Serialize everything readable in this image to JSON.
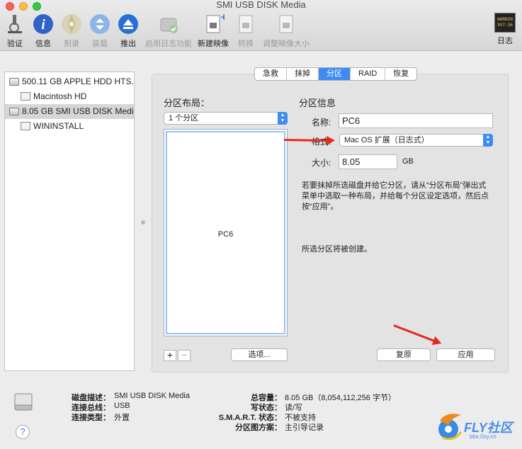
{
  "window": {
    "title": "SMI USB DISK Media"
  },
  "toolbar": {
    "items": [
      {
        "label": "验证",
        "icon": "microscope-icon",
        "enabled": true
      },
      {
        "label": "信息",
        "icon": "info-icon",
        "enabled": true
      },
      {
        "label": "刻录",
        "icon": "burn-disc-icon",
        "enabled": false
      },
      {
        "label": "装载",
        "icon": "mount-icon",
        "enabled": false
      },
      {
        "label": "推出",
        "icon": "eject-icon",
        "enabled": true
      },
      {
        "label": "启用日志功能",
        "icon": "journal-icon",
        "enabled": false
      },
      {
        "label": "新建映像",
        "icon": "new-image-icon",
        "enabled": true
      },
      {
        "label": "转换",
        "icon": "convert-icon",
        "enabled": false
      },
      {
        "label": "调整映像大小",
        "icon": "resize-image-icon",
        "enabled": false
      }
    ],
    "log": {
      "label": "日志",
      "badge_line1": "WARNIN",
      "badge_line2": "9V7:36"
    }
  },
  "sidebar": {
    "items": [
      {
        "label": "500.11 GB APPLE HDD HTS...",
        "kind": "drive",
        "selected": false
      },
      {
        "label": "Macintosh HD",
        "kind": "volume",
        "selected": false
      },
      {
        "label": "8.05 GB SMI USB DISK Media",
        "kind": "drive",
        "selected": true
      },
      {
        "label": "WININSTALL",
        "kind": "volume",
        "selected": false
      }
    ]
  },
  "tabs": [
    {
      "label": "急救",
      "active": false
    },
    {
      "label": "抹掉",
      "active": false
    },
    {
      "label": "分区",
      "active": true
    },
    {
      "label": "RAID",
      "active": false
    },
    {
      "label": "恢复",
      "active": false
    }
  ],
  "partition": {
    "layout_title": "分区布局：",
    "layout_select": "1 个分区",
    "partition_name_in_layout": "PC6",
    "info_title": "分区信息",
    "name_label": "名称:",
    "name_value": "PC6",
    "format_label": "格式:",
    "format_value": "Mac OS 扩展（日志式）",
    "size_label": "大小:",
    "size_value": "8.05",
    "size_unit": "GB",
    "description": "若要抹掉所选磁盘并给它分区，请从“分区布局”弹出式菜单中选取一种布局，并给每个分区设定选项，然后点按“应用”。",
    "status": "所选分区将被创建。",
    "plus_label": "+",
    "minus_label": "−",
    "options_button": "选项...",
    "revert_button": "复原",
    "apply_button": "应用"
  },
  "footer": {
    "left": [
      {
        "key": "磁盘描述：",
        "value": "SMI USB DISK Media"
      },
      {
        "key": "连接总线：",
        "value": "USB"
      },
      {
        "key": "连接类型：",
        "value": "外置"
      }
    ],
    "right": [
      {
        "key": "总容量：",
        "value": "8.05 GB（8,054,112,256 字节）"
      },
      {
        "key": "写状态：",
        "value": "读/写"
      },
      {
        "key": "S.M.A.R.T. 状态：",
        "value": "不被支持"
      },
      {
        "key": "分区图方案：",
        "value": "主引导记录"
      }
    ],
    "help": "?"
  },
  "watermark": {
    "text": "FLY社区",
    "sub": "bbs.0xy.cn"
  },
  "colors": {
    "accent": "#3f8bf3",
    "arrow": "#e52a1c"
  }
}
